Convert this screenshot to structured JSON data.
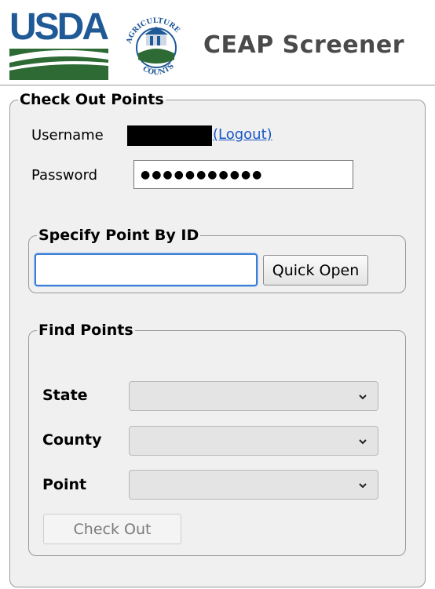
{
  "header": {
    "usda_logo_text": "USDA",
    "seal_text_top": "AGRICULTURE",
    "seal_text_bottom": "COUNTS",
    "app_title": "CEAP Screener"
  },
  "checkout": {
    "legend": "Check Out Points",
    "username_label": "Username",
    "logout_link": "(Logout)",
    "password_label": "Password",
    "password_value": "●●●●●●●●●●●"
  },
  "specify": {
    "legend": "Specify Point By ID",
    "id_value": "",
    "quick_open_label": "Quick Open"
  },
  "find": {
    "legend": "Find Points",
    "state_label": "State",
    "county_label": "County",
    "point_label": "Point",
    "checkout_button": "Check Out"
  },
  "colors": {
    "usda_blue": "#1f5a96",
    "usda_green": "#2e7d32",
    "link_blue": "#1a57c6",
    "focus_blue": "#3d7fd6"
  },
  "icons": [
    "chevron-down-icon"
  ]
}
